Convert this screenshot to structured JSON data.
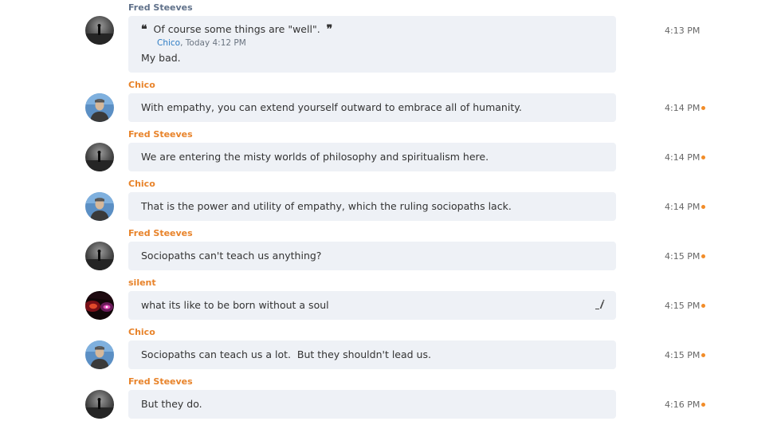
{
  "colors": {
    "sender_fred": "#60718a",
    "sender_other": "#e8832a",
    "unread_dot": "#f28c28",
    "bubble_bg": "#eef1f6",
    "quote_author": "#2e7cc4"
  },
  "messages": [
    {
      "sender": "Fred Steeves",
      "avatar": "fred-avatar",
      "quote": {
        "text": "Of course some things are \"well\".",
        "author": "Chico",
        "time": ", Today 4:12 PM"
      },
      "text": "My bad.",
      "time": "4:13 PM",
      "unread": false
    },
    {
      "sender": "Chico",
      "avatar": "chico-avatar",
      "text": "With empathy, you can extend yourself outward to embrace all of humanity.",
      "time": "4:14 PM",
      "unread": true
    },
    {
      "sender": "Fred Steeves",
      "avatar": "fred-avatar",
      "text": "We are entering the misty worlds of philosophy and spiritualism here.",
      "time": "4:14 PM",
      "unread": true
    },
    {
      "sender": "Chico",
      "avatar": "chico-avatar",
      "text": "That is the power and utility of empathy, which the ruling sociopaths lack.",
      "time": "4:14 PM",
      "unread": true
    },
    {
      "sender": "Fred Steeves",
      "avatar": "fred-avatar",
      "text": "Sociopaths can't teach us anything?",
      "time": "4:15 PM",
      "unread": true
    },
    {
      "sender": "silent",
      "avatar": "silent-avatar",
      "text": "what its like to be born without a soul",
      "time": "4:15 PM",
      "unread": true,
      "edited_icon": "edit-pencil-icon"
    },
    {
      "sender": "Chico",
      "avatar": "chico-avatar",
      "text": "Sociopaths can teach us a lot.  But they shouldn't lead us.",
      "time": "4:15 PM",
      "unread": true
    },
    {
      "sender": "Fred Steeves",
      "avatar": "fred-avatar",
      "text": "But they do.",
      "time": "4:16 PM",
      "unread": true
    }
  ]
}
